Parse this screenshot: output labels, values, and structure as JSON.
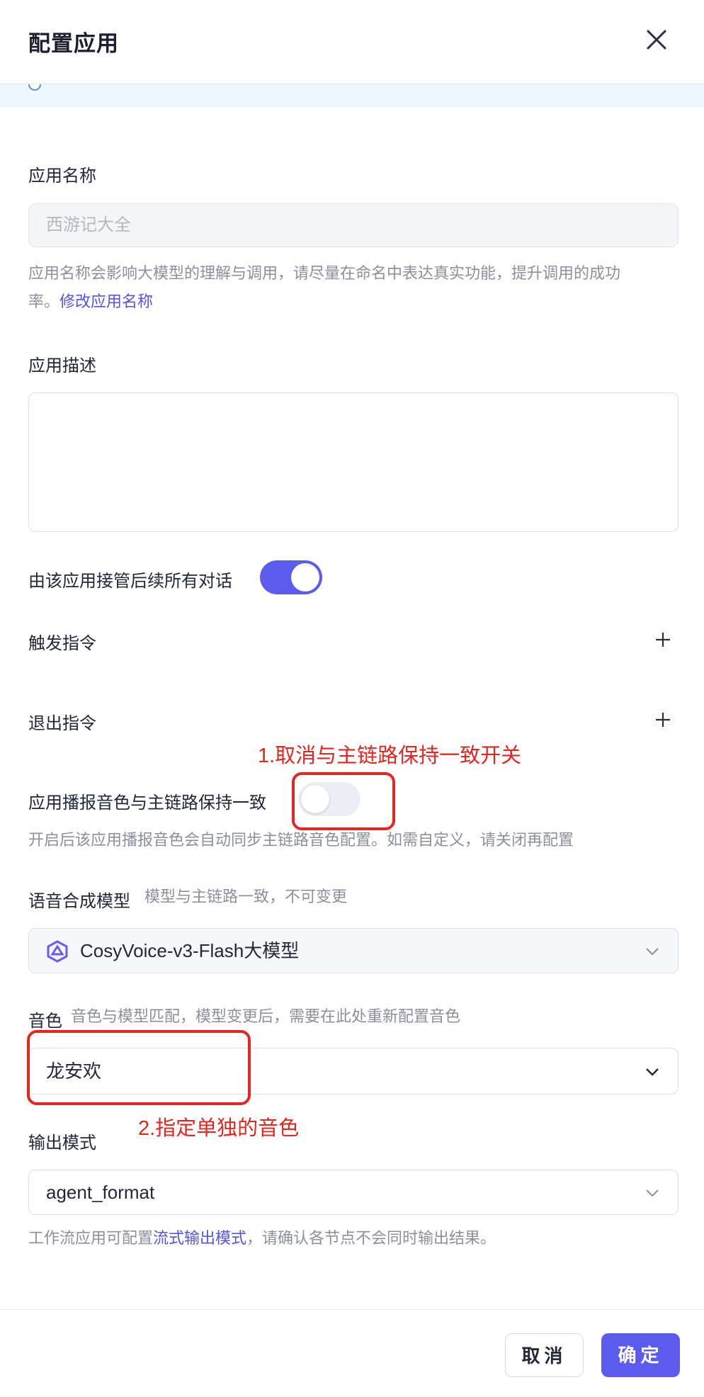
{
  "dialog": {
    "title": "配置应用"
  },
  "app_name": {
    "label": "应用名称",
    "value": "西游记大全",
    "helper": "应用名称会影响大模型的理解与调用，请尽量在命名中表达真实功能，提升调用的成功",
    "helper_line2": "率。",
    "link": "修改应用名称"
  },
  "app_desc": {
    "label": "应用描述",
    "value": ""
  },
  "takeover": {
    "label": "由该应用接管后续所有对话",
    "enabled": true
  },
  "trigger": {
    "label": "触发指令"
  },
  "exit": {
    "label": "退出指令"
  },
  "voice_sync": {
    "label": "应用播报音色与主链路保持一致",
    "enabled": false,
    "helper": "开启后该应用播报音色会自动同步主链路音色配置。如需自定义，请关闭再配置"
  },
  "tts_model": {
    "label": "语音合成模型",
    "hint": "模型与主链路一致，不可变更",
    "value": "CosyVoice-v3-Flash大模型"
  },
  "voice": {
    "label": "音色",
    "hint": "音色与模型匹配，模型变更后，需要在此处重新配置音色",
    "value": "龙安欢"
  },
  "output_mode": {
    "label": "输出模式",
    "value": "agent_format",
    "helper_prefix": "工作流应用可配置",
    "helper_link": "流式输出模式",
    "helper_suffix": "，请确认各节点不会同时输出结果。"
  },
  "annotations": {
    "note1": "1.取消与主链路保持一致开关",
    "note2": "2.指定单独的音色"
  },
  "footer": {
    "cancel": "取消",
    "confirm": "确定"
  },
  "colors": {
    "accent": "#5b5bef",
    "link": "#5553e6",
    "annotation": "#e3261f"
  }
}
